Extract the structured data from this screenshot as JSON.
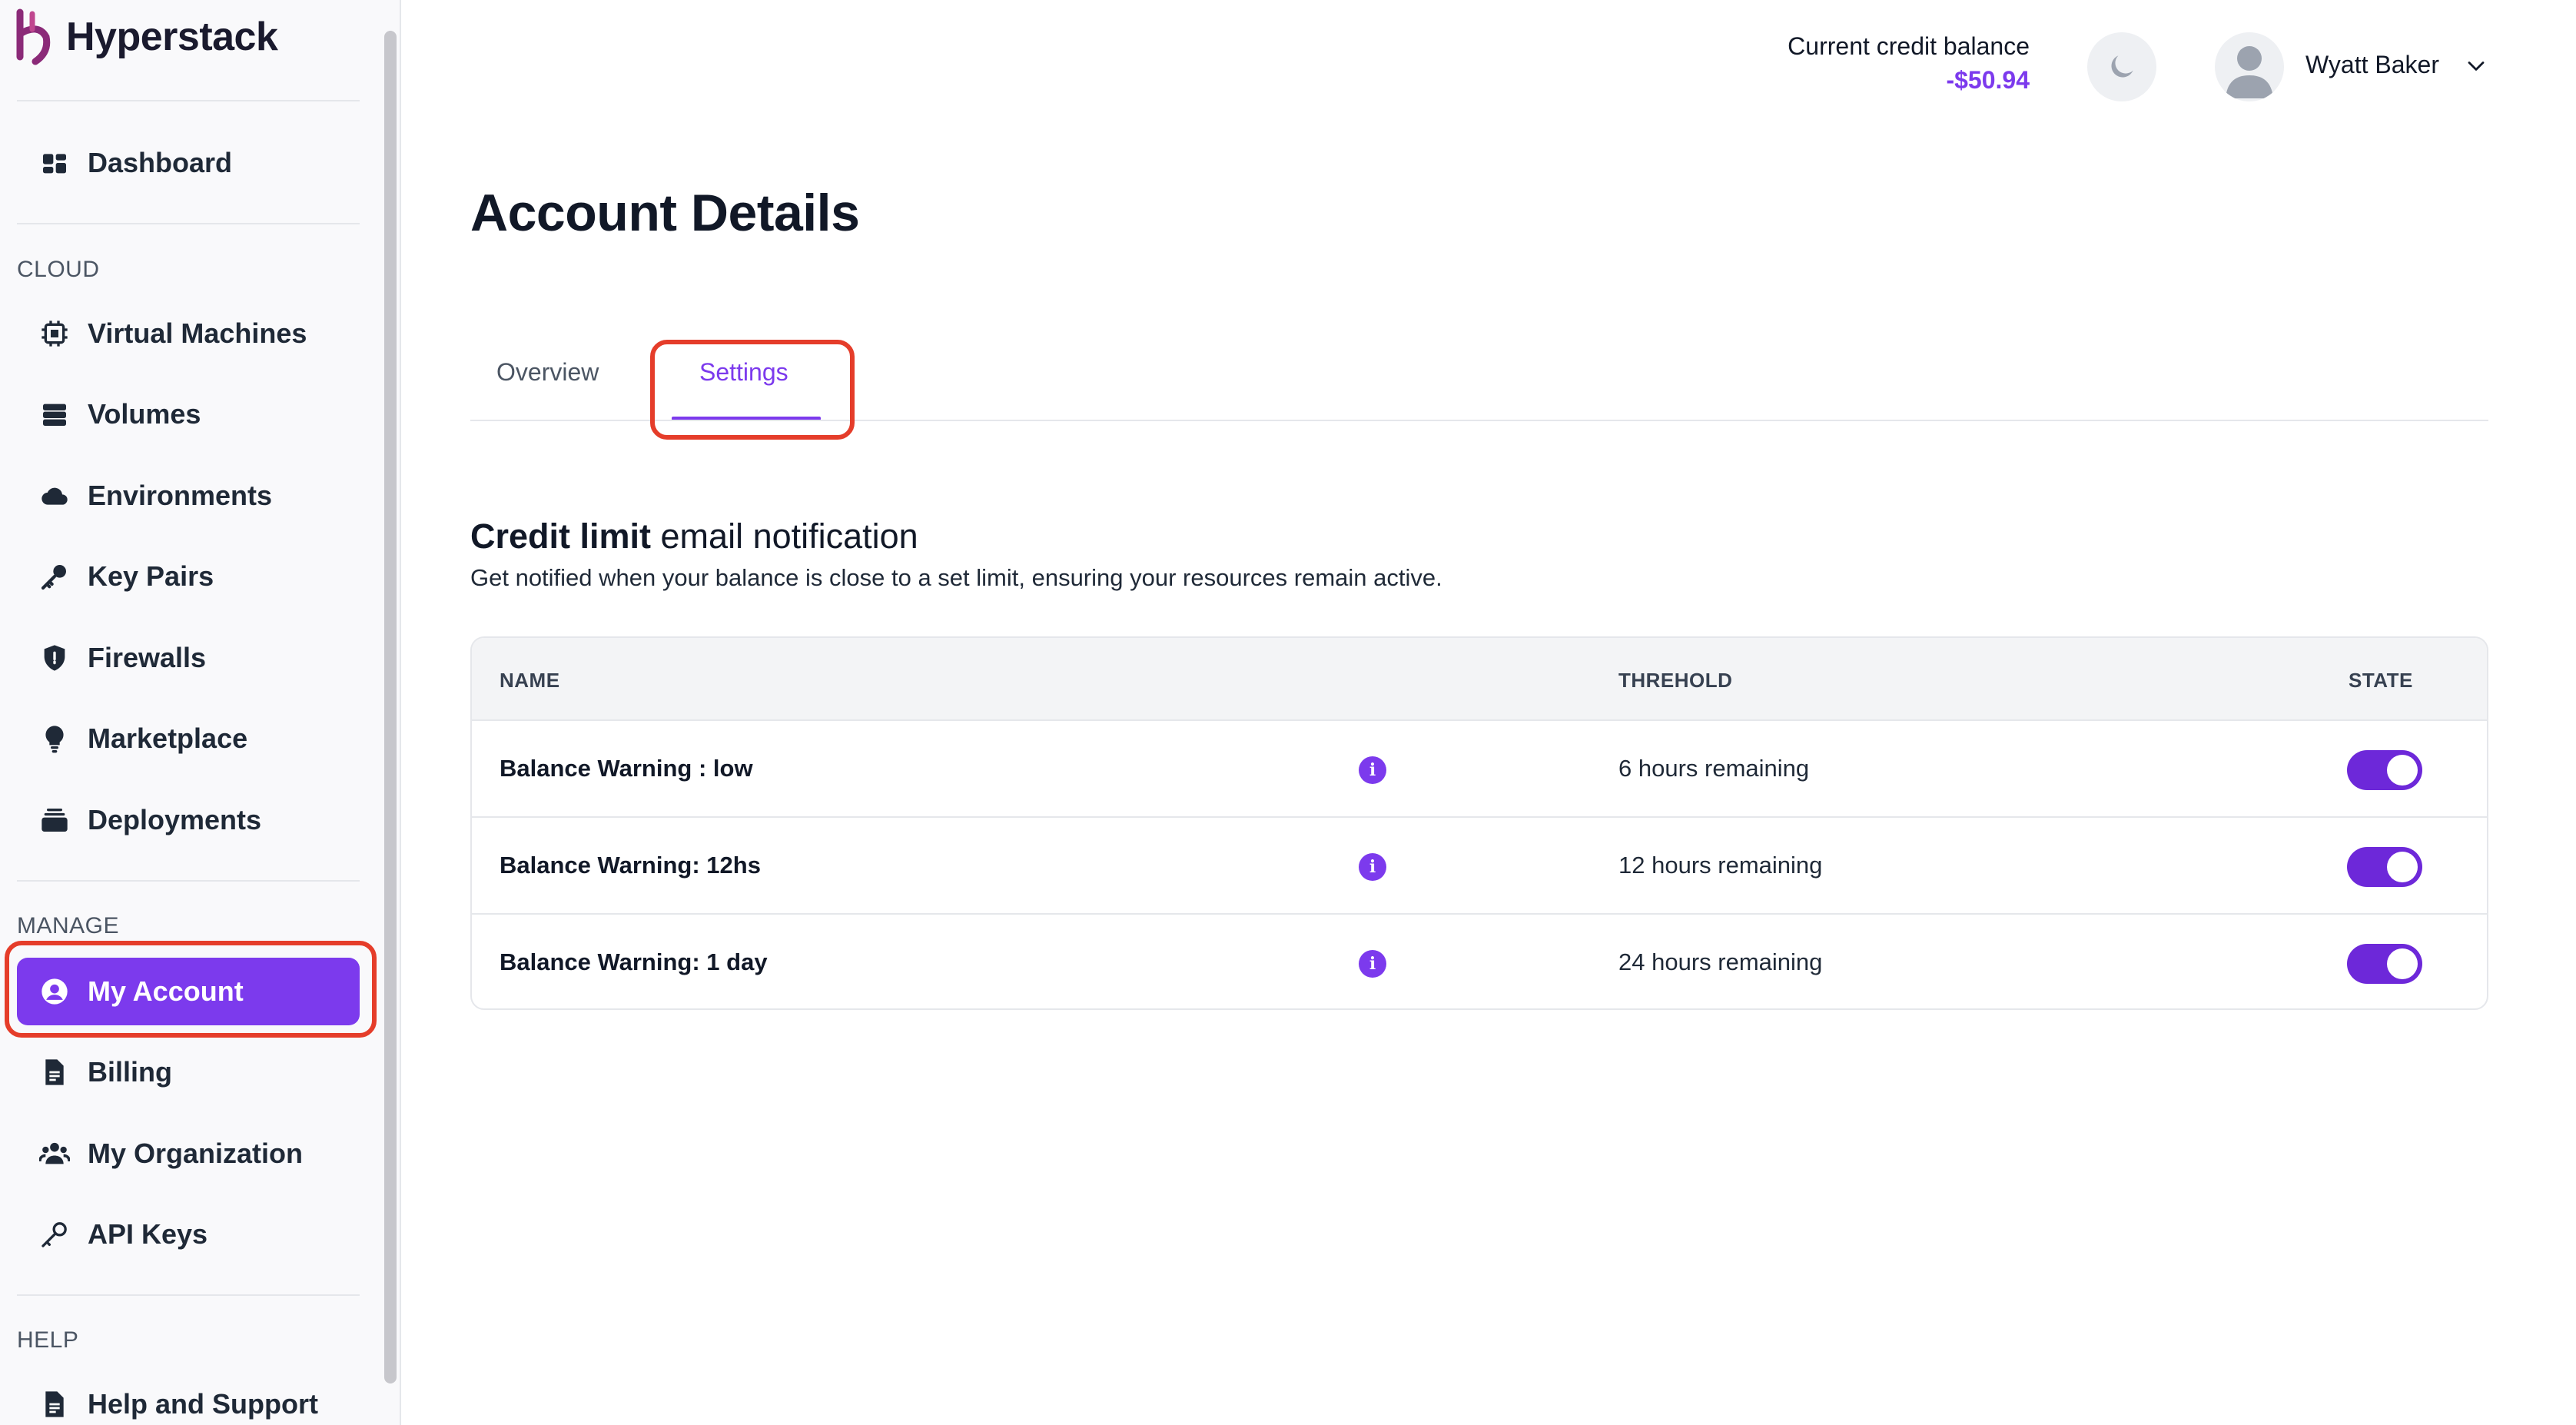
{
  "brand": {
    "name": "Hyperstack",
    "accent": "#7c3aed",
    "highlight": "#e53d2a"
  },
  "sidebar": {
    "dashboard": {
      "label": "Dashboard",
      "icon": "dashboard-icon"
    },
    "sections": {
      "cloud": "CLOUD",
      "manage": "MANAGE",
      "help": "HELP"
    },
    "cloud_items": [
      {
        "label": "Virtual Machines",
        "icon": "chip-icon"
      },
      {
        "label": "Volumes",
        "icon": "database-icon"
      },
      {
        "label": "Environments",
        "icon": "cloud-icon"
      },
      {
        "label": "Key Pairs",
        "icon": "key-icon"
      },
      {
        "label": "Firewalls",
        "icon": "shield-icon"
      },
      {
        "label": "Marketplace",
        "icon": "lightbulb-icon"
      },
      {
        "label": "Deployments",
        "icon": "layers-icon"
      }
    ],
    "manage_items": [
      {
        "label": "My Account",
        "icon": "user-circle-icon",
        "active": true
      },
      {
        "label": "Billing",
        "icon": "document-icon"
      },
      {
        "label": "My Organization",
        "icon": "users-icon"
      },
      {
        "label": "API Keys",
        "icon": "key-outline-icon"
      }
    ],
    "help_items": [
      {
        "label": "Help and Support",
        "icon": "document-icon"
      }
    ]
  },
  "header": {
    "credit_label": "Current credit balance",
    "credit_value": "-$50.94",
    "user_name": "Wyatt Baker"
  },
  "page": {
    "title": "Account Details",
    "tabs": [
      {
        "label": "Overview",
        "active": false
      },
      {
        "label": "Settings",
        "active": true
      }
    ],
    "section_title_bold": "Credit limit",
    "section_title_rest": " email notification",
    "section_desc": "Get notified when your balance is close to a set limit, ensuring your resources remain active."
  },
  "table": {
    "headers": {
      "name": "NAME",
      "threshold": "THREHOLD",
      "state": "STATE"
    },
    "rows": [
      {
        "name": "Balance Warning : low",
        "threshold": "6 hours remaining",
        "enabled": true
      },
      {
        "name": "Balance Warning: 12hs",
        "threshold": "12 hours remaining",
        "enabled": true
      },
      {
        "name": "Balance Warning: 1 day",
        "threshold": "24 hours remaining",
        "enabled": true
      }
    ]
  }
}
